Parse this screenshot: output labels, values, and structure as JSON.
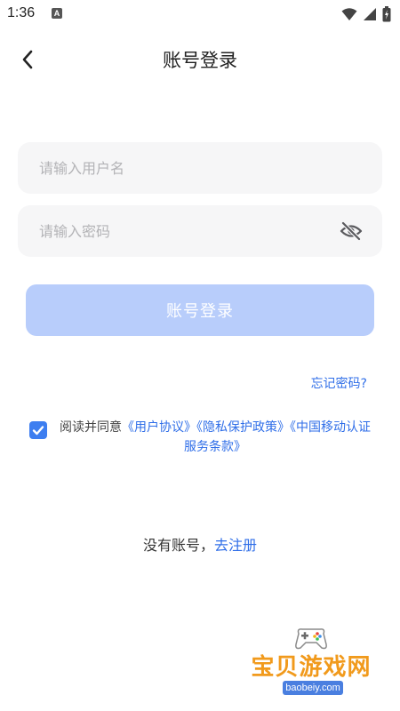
{
  "status_bar": {
    "time": "1:36",
    "notification_glyph": "A"
  },
  "header": {
    "title": "账号登录",
    "back_icon": "chevron-left-icon"
  },
  "form": {
    "username": {
      "placeholder": "请输入用户名",
      "value": ""
    },
    "password": {
      "placeholder": "请输入密码",
      "value": "",
      "visibility_icon": "eye-off-icon"
    },
    "login_button": "账号登录",
    "forgot_password": "忘记密码?"
  },
  "agreement": {
    "checked": true,
    "prefix": "阅读并同意",
    "user_agreement": "《用户协议》",
    "privacy_policy": "《隐私保护政策》",
    "cmcc_terms": "《中国移动认证服务条款》"
  },
  "register": {
    "prompt": "没有账号，",
    "link": "去注册"
  },
  "watermark": {
    "brand": "宝贝游戏网",
    "url": "baobeiy.com"
  },
  "colors": {
    "accent": "#2f6ee8",
    "button_disabled": "#b8cdfb",
    "input_bg": "#f6f6f7",
    "checkbox": "#3d7ef0"
  }
}
